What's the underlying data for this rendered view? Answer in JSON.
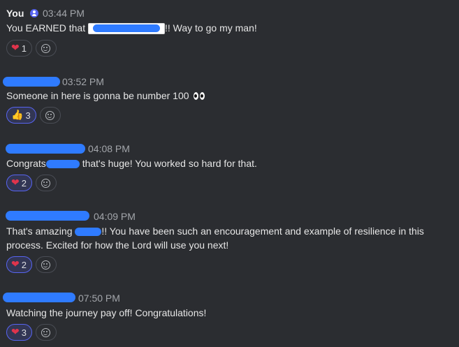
{
  "messages": [
    {
      "author": "You",
      "time": "03:44 PM",
      "text_before": "You EARNED that",
      "text_after": "!! Way to go my man!",
      "reactions": [
        {
          "emoji": "heart",
          "count": "1"
        }
      ]
    },
    {
      "author": "",
      "time": "03:52 PM",
      "text": "Someone in here is gonna be number 100",
      "reactions": [
        {
          "emoji": "thumbs-up",
          "count": "3"
        }
      ]
    },
    {
      "author": "",
      "time": "04:08 PM",
      "text_before": "Congrats",
      "text_after": "that's huge! You worked so hard for that.",
      "reactions": [
        {
          "emoji": "heart",
          "count": "2"
        }
      ]
    },
    {
      "author": "",
      "time": "04:09 PM",
      "text_before": "That's amazing",
      "text_after": "!! You have been such an encouragement and example of resilience in this process. Excited for how the Lord will use you next!",
      "reactions": [
        {
          "emoji": "heart",
          "count": "2"
        }
      ]
    },
    {
      "author": "",
      "time": "07:50 PM",
      "text": "Watching the journey pay off! Congratulations!",
      "reactions": [
        {
          "emoji": "heart",
          "count": "3"
        }
      ]
    }
  ],
  "icons": {
    "heart": "❤",
    "thumbs_up": "👍",
    "add_reaction": "smile-plus-icon"
  },
  "colors": {
    "background": "#2b2d31",
    "accent": "#5865f2",
    "redaction": "#2f7bff",
    "heart": "#e0344c"
  }
}
